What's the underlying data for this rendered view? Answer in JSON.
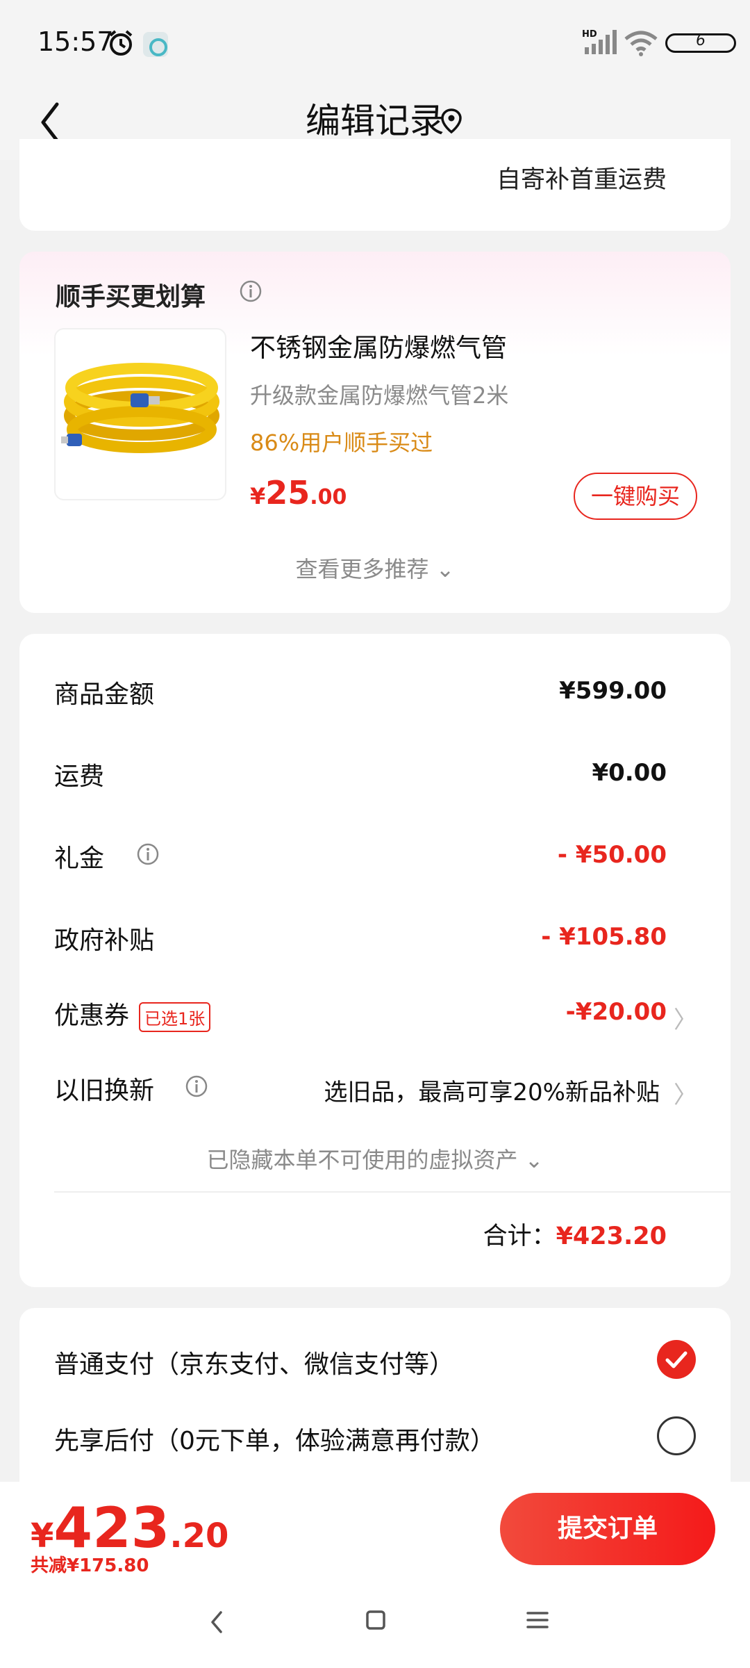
{
  "status_bar": {
    "time": "15:57",
    "network": "HD",
    "battery": "6"
  },
  "header": {
    "title": "编辑记录"
  },
  "shipping": {
    "note": "自寄补首重运费"
  },
  "recommend": {
    "title": "顺手买更划算",
    "product": {
      "name": "不锈钢金属防爆燃气管",
      "subtitle": "升级款金属防爆燃气管2米",
      "social_proof": "86%用户顺手买过",
      "price_currency": "¥",
      "price_int": "25",
      "price_dec": ".00",
      "image_icon": "gas-hose-icon"
    },
    "buy_label": "一键购买",
    "more_label": "查看更多推荐 ⌄"
  },
  "summary": {
    "rows": [
      {
        "label": "商品金额",
        "value": "¥599.00"
      },
      {
        "label": "运费",
        "value": "¥0.00"
      },
      {
        "label": "礼金",
        "value": "- ¥50.00"
      },
      {
        "label": "政府补贴",
        "value": "- ¥105.80"
      },
      {
        "label": "优惠券",
        "badge": "已选1张",
        "value": "-¥20.00"
      },
      {
        "label": "以旧换新",
        "value": "选旧品，最高可享20%新品补贴"
      }
    ],
    "hidden_assets": "已隐藏本单不可使用的虚拟资产 ⌄",
    "total_label": "合计：",
    "total_value": "¥423.20"
  },
  "payment": {
    "options": [
      {
        "label": "普通支付（京东支付、微信支付等）",
        "selected": true
      },
      {
        "label": "先享后付（0元下单，体验满意再付款）",
        "selected": false
      }
    ]
  },
  "bottom_bar": {
    "price_currency": "¥",
    "price_int": "423",
    "price_dec": ".20",
    "discount": "共减¥175.80",
    "submit_label": "提交订单"
  },
  "colors": {
    "accent": "#e8261e",
    "orange": "#d98a16",
    "background": "#f2f2f2"
  }
}
